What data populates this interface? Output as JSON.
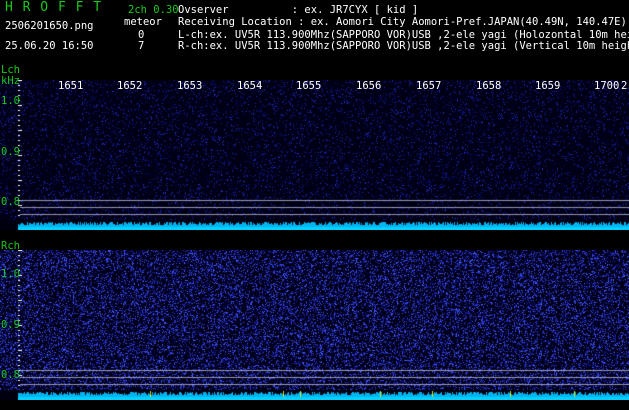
{
  "header": {
    "app_name": "H R O F F T",
    "filename": "2506201650.png",
    "datetime": "25.06.20 16:50",
    "version": "2ch 0.30",
    "meteor_label": "meteor",
    "meteor_count_l": "0",
    "meteor_count_r": "7",
    "observer_line": "Ovserver          : ex. JR7CYX [ kid ]",
    "location_line": "Receiving Location : ex. Aomori City Aomori-Pref.JAPAN(40.49N, 140.47E)",
    "lch_line": "L-ch:ex. UV5R 113.900Mhz(SAPPORO VOR)USB ,2-ele yagi (Holozontal 10m height)",
    "rch_line": "R-ch:ex. UV5R 113.900Mhz(SAPPORO VOR)USB ,2-ele yagi (Vertical 10m height)"
  },
  "axis": {
    "time_labels": [
      "1651",
      "1652",
      "1653",
      "1654",
      "1655",
      "1656",
      "1657",
      "1658",
      "1659",
      "1700",
      "2"
    ]
  },
  "lch": {
    "title": "Lch",
    "unit": "kHz",
    "freq_labels": [
      "1.0",
      "0.9",
      "0.8"
    ]
  },
  "rch": {
    "title": "Rch",
    "freq_labels": [
      "1.0",
      "0.9",
      "0.8"
    ]
  },
  "colors": {
    "green": "#18c818",
    "white": "#ffffff",
    "cyan": "#00c8ff",
    "bg": "#000000",
    "noise_l": "#1e2a8c",
    "noise_r": "#3c50ff"
  }
}
